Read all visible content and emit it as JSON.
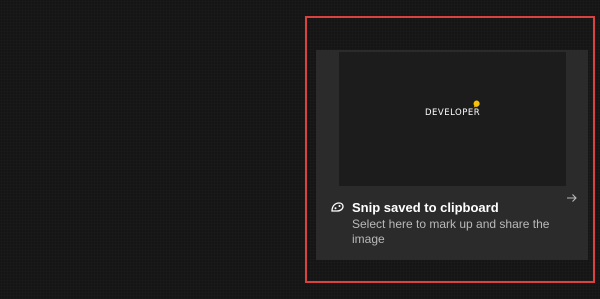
{
  "preview": {
    "text": "DEVELOPER",
    "badge_color": "#f4c20d"
  },
  "toast": {
    "icon": "snip-icon",
    "title": "Snip saved to clipboard",
    "body": "Select here to mark up and share the image",
    "action_icon": "arrow-right-icon"
  },
  "colors": {
    "highlight": "#d8433f",
    "toast_bg": "#2b2b2b",
    "background": "#151515"
  }
}
